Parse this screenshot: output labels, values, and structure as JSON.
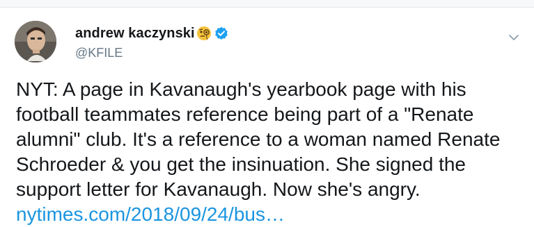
{
  "tweet": {
    "author": {
      "display_name": "andrew kaczynski",
      "handle": "@KFILE",
      "emoji_icon": "face-with-monocle-icon",
      "verified_icon": "verified-badge-icon",
      "verified_color": "#1da1f2"
    },
    "menu_icon": "chevron-down-icon",
    "text_lines": [
      "NYT: A page in Kavanaugh's yearbook page with his",
      "football teammates reference being part of a \"Renate",
      "alumni\" club. It's a reference to a woman named Renate",
      "Schroeder & you get the insinuation. She signed the",
      "support letter for Kavanaugh. Now she's angry."
    ],
    "link_text": "nytimes.com/2018/09/24/bus…",
    "link_color": "#1b95e0"
  }
}
